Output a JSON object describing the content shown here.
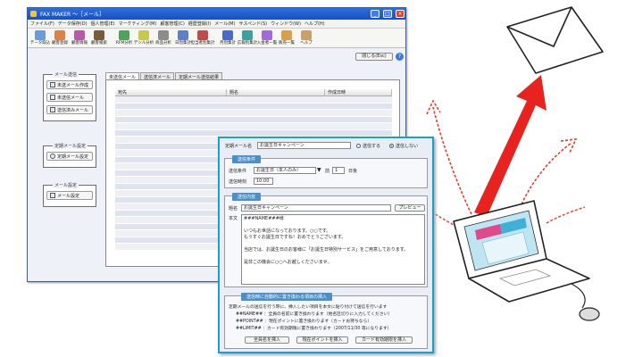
{
  "window": {
    "title": "FAX MAKER ～［メール］"
  },
  "menu": [
    "ファイル(F)",
    "データ保存(D)",
    "個人管理(E)",
    "マーケティング(M)",
    "顧客管理(C)",
    "経歴登録(I)",
    "メール(M)",
    "サスペンド(S)",
    "ウィンドウ(W)",
    "ヘルプ(H)"
  ],
  "toolbar": [
    {
      "label": "データ取込",
      "color": "#6a9bd6"
    },
    {
      "label": "顧客登録",
      "color": "#d9824a"
    },
    {
      "label": "顧客情報",
      "color": "#b85aa8"
    },
    {
      "label": "顧客検索",
      "color": "#7a5b3a"
    },
    {
      "label": "RFM分析",
      "color": "#4fa25c"
    },
    {
      "label": "デシル分析",
      "color": "#c8c84a"
    },
    {
      "label": "商品分析",
      "color": "#8c8c8c"
    },
    {
      "label": "日別集計",
      "color": "#5b7fc8"
    },
    {
      "label": "担当者別集計",
      "color": "#c04a4a"
    },
    {
      "label": "月別集計",
      "color": "#4a6ac8"
    },
    {
      "label": "広報別集計",
      "color": "#3aa0a0"
    },
    {
      "label": "入金者一覧",
      "color": "#a06ad8"
    },
    {
      "label": "販売一覧",
      "color": "#d8a04a"
    },
    {
      "label": "ヘルプ",
      "color": "#c8a06a"
    }
  ],
  "read_button": "閉じる(Esc)",
  "help_icon": "?",
  "side": {
    "mail_send": {
      "title": "メール送信",
      "buttons": [
        "未送メール作成",
        "未送信メール",
        "送信済みメール"
      ]
    },
    "scheduled": {
      "title": "定期メール設定",
      "buttons": [
        "定期メール設定"
      ]
    },
    "mail_settings": {
      "title": "メール設定",
      "buttons": [
        "メール設定"
      ]
    }
  },
  "tabs": [
    "未送信メール",
    "送信済メール",
    "定期メール送信結果"
  ],
  "list_columns": [
    "宛先",
    "題名",
    "作成日時"
  ],
  "dialog": {
    "mail_name_label": "定期メール名",
    "mail_name_value": "お誕生日キャンペーン",
    "radio_send": "送信する",
    "radio_nosend": "送信しない",
    "send_condition_title": "送信条件",
    "condition_label": "送信条件",
    "condition_value": "お誕生日（本人のみ）",
    "before_after": "前",
    "days_value": "1",
    "days_unit": "日後",
    "time_label": "送信時刻",
    "time_value": "10:00",
    "content_title": "送信内容",
    "subject_label": "題名",
    "subject_value": "お誕生日キャンペーン",
    "preview_button": "プレビュー",
    "body_label": "本文",
    "body_lines": [
      "###NAME###様",
      "",
      "いつもお世話になっております。○○です。",
      "もうすぐお誕生日ですね！おめでとうございます。",
      "",
      "当店では、お誕生日のお客様に「お誕生日特別サービス」をご用意しております。",
      "",
      "是非この機会に○○へお越しくださいませ。"
    ],
    "insert_title": "送信時に自動的に置き換わる項目の挿入",
    "insert_lines": [
      "定期メールの送信を行う際に、挿入したい項目を本文に貼り付けて送信を行います",
      "##NAME## ：全員の名前に置き換わります（姓名区切りに入力してください）",
      "##POINT## ：現在ポイントに置き換わります（カードお持ちなら）",
      "##LIMIT## ：カード有効期限に置き換わります（2007/11/30 等になります）"
    ],
    "insert_buttons": [
      "全員名を挿入",
      "現在ポイントを挿入",
      "カード有効期限を挿入"
    ]
  }
}
